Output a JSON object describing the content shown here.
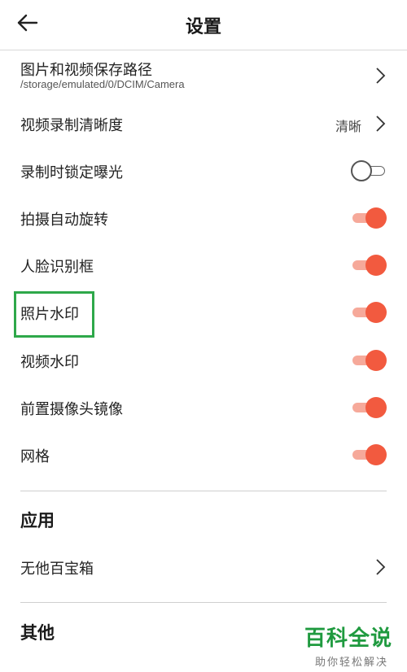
{
  "header": {
    "title": "设置"
  },
  "settings": {
    "save_path": {
      "label": "图片和视频保存路径",
      "path": "/storage/emulated/0/DCIM/Camera"
    },
    "video_quality": {
      "label": "视频录制清晰度",
      "value": "清晰"
    },
    "lock_exposure": {
      "label": "录制时锁定曝光",
      "enabled": false
    },
    "auto_rotate": {
      "label": "拍摄自动旋转",
      "enabled": true
    },
    "face_frame": {
      "label": "人脸识别框",
      "enabled": true
    },
    "photo_watermark": {
      "label": "照片水印",
      "enabled": true
    },
    "video_watermark": {
      "label": "视频水印",
      "enabled": true
    },
    "front_mirror": {
      "label": "前置摄像头镜像",
      "enabled": true
    },
    "grid": {
      "label": "网格",
      "enabled": true
    }
  },
  "apps_section": {
    "title": "应用",
    "toolbox_label": "无他百宝箱"
  },
  "other_section": {
    "title": "其他"
  },
  "watermark": {
    "title": "百科全说",
    "subtitle": "助你轻松解决"
  },
  "colors": {
    "toggle_on": "#f25a3f",
    "toggle_track_on": "#f6a99a",
    "highlight": "#2ea84a",
    "watermark_green": "#1f9a3f"
  }
}
